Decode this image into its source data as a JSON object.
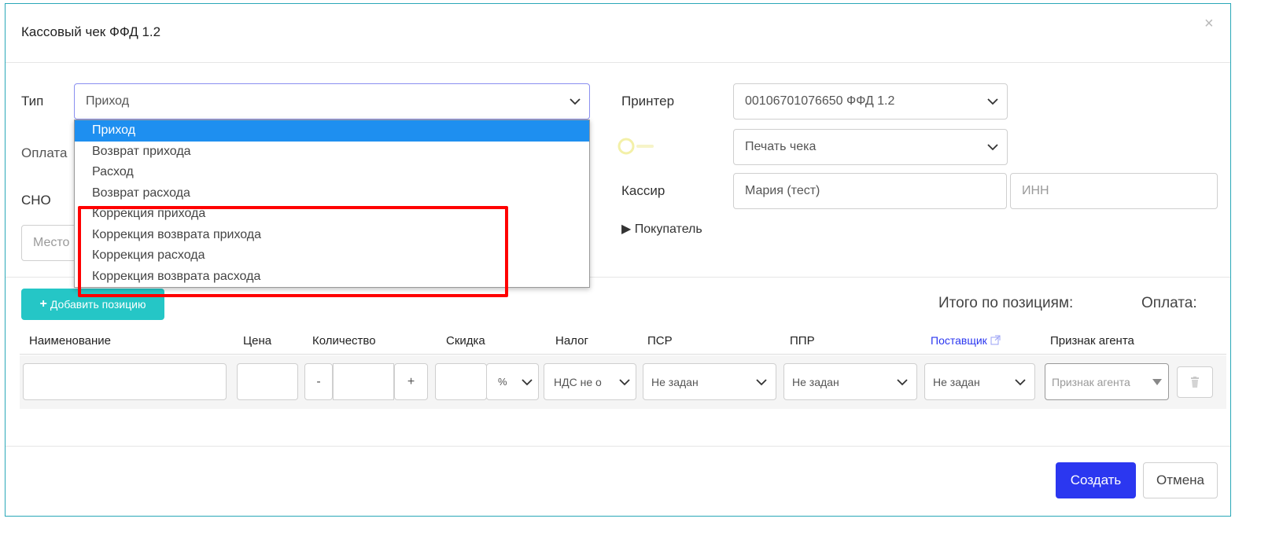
{
  "dialog": {
    "title": "Кассовый чек ФФД 1.2",
    "close_glyph": "×"
  },
  "form": {
    "type_label": "Тип",
    "type_value": "Приход",
    "payment_label": "Оплата",
    "sno_label": "СНО",
    "place_placeholder": "Место",
    "printer_label": "Принтер",
    "printer_value": "00106701076650 ФФД 1.2",
    "print_mode_value": "Печать чека",
    "cashier_label": "Кассир",
    "cashier_value": "Мария (тест)",
    "inn_placeholder": "ИНН",
    "buyer_toggle": "▶ Покупатель"
  },
  "type_dropdown": {
    "options": [
      "Приход",
      "Возврат прихода",
      "Расход",
      "Возврат расхода",
      "Коррекция прихода",
      "Коррекция возврата прихода",
      "Коррекция расхода",
      "Коррекция возврата расхода"
    ],
    "selected_index": 0,
    "highlight_color": "#ff0000"
  },
  "positions": {
    "add_button": "Добавить позицию",
    "add_icon": "plus-icon",
    "total_label": "Итого по позициям:",
    "payment_label": "Оплата:",
    "columns": {
      "name": "Наименование",
      "price": "Цена",
      "quantity": "Количество",
      "discount": "Скидка",
      "tax": "Налог",
      "psr": "ПСР",
      "ppr": "ППР",
      "supplier": "Поставщик",
      "agent": "Признак агента"
    },
    "row": {
      "minus": "-",
      "plus": "+",
      "discount_unit": "%",
      "tax_value": "НДС не о",
      "psr_value": "Не задан",
      "ppr_value": "Не задан",
      "supplier_value": "Не задан",
      "agent_placeholder": "Признак агента"
    }
  },
  "footer": {
    "create_button": "Создать",
    "cancel_button": "Отмена"
  },
  "colors": {
    "primary": "#2b37f0",
    "accent": "#25c6c6",
    "dropdown_selected": "#1e8ff0",
    "link": "#2b37f0"
  }
}
